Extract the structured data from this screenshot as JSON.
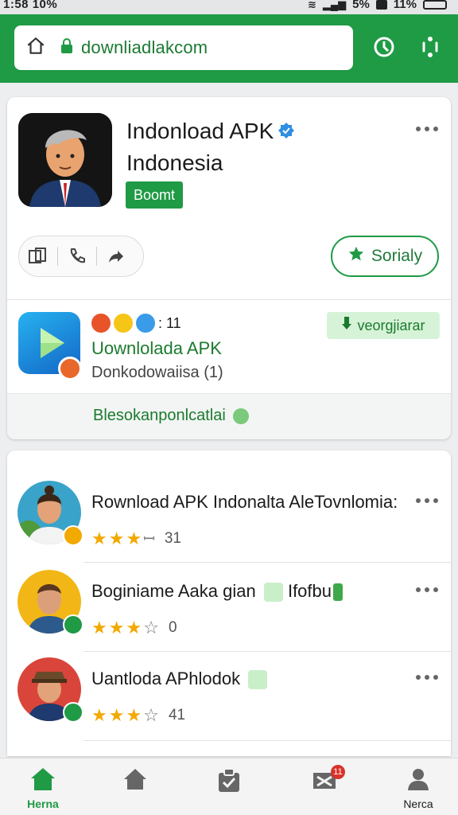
{
  "status_bar": {
    "time": "1:58 10%",
    "battery": "11%",
    "signal_text": "5%"
  },
  "browser": {
    "url": "downliadlakcom",
    "home_icon": "home-icon",
    "lock_icon": "lock-icon",
    "history_icon": "clock-icon",
    "menu_icon": "more-icon"
  },
  "app_card": {
    "title_line1": "Indonload APK",
    "title_line2": "Indonesia",
    "badge": "Boomt",
    "follow_label": "Sorialy",
    "actions": [
      "screen-share-icon",
      "phone-icon",
      "share-icon"
    ]
  },
  "secondary_app": {
    "reaction_count": ": 11",
    "title": "Uownlolada APK",
    "subtitle": "Donkodowaiisa (1)",
    "install_label": "veorgjiarar",
    "footer_label": "Blesokanponlcatlai"
  },
  "list": [
    {
      "title": "Rownload APK Indonalta AleTovnlomia:",
      "stars": 3,
      "rating_text": "31",
      "badge_color": "#f2a900"
    },
    {
      "title": "Boginiame Aaka gian",
      "extra": "Ifofbu",
      "stars": 3,
      "rating_text": "0",
      "badge_color": "#1f9a45"
    },
    {
      "title": "Uantloda APhlodok",
      "stars": 3,
      "rating_text": "41",
      "badge_color": "#1f9a45"
    }
  ],
  "bottom_nav": [
    {
      "label": "Herna",
      "icon": "home-icon",
      "active": true
    },
    {
      "label": "",
      "icon": "store-icon",
      "active": false
    },
    {
      "label": "",
      "icon": "clipboard-icon",
      "active": false
    },
    {
      "label": "",
      "icon": "mail-icon",
      "active": false,
      "badge": "11"
    },
    {
      "label": "Nerca",
      "icon": "profile-icon",
      "active": false
    }
  ],
  "colors": {
    "primary": "#1f9a45",
    "accent": "#1f7a3a",
    "star": "#f2a900"
  }
}
